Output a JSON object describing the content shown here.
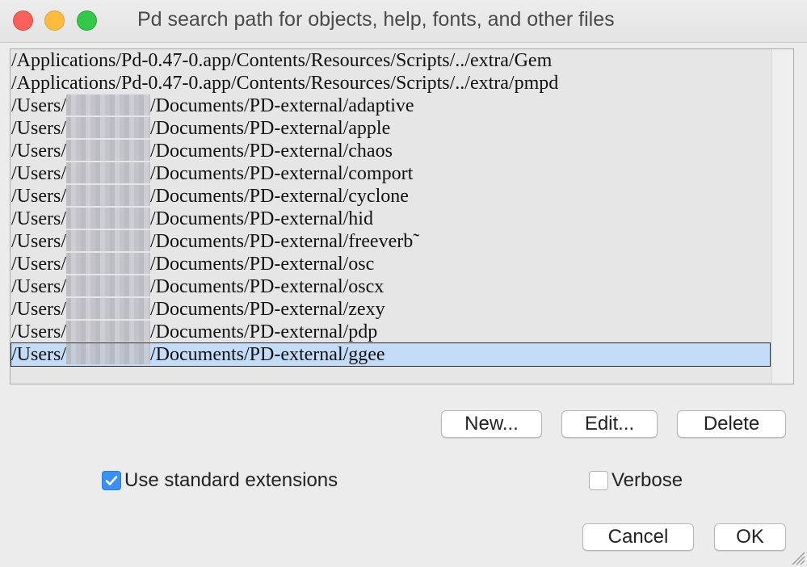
{
  "window": {
    "title": "Pd search path for objects, help, fonts, and other files"
  },
  "path_list": {
    "items": [
      {
        "prefix": "/Applications/Pd-0.47-0.app/Contents/Resources/Scripts/../extra/Gem",
        "redacted": false,
        "suffix": ""
      },
      {
        "prefix": "/Applications/Pd-0.47-0.app/Contents/Resources/Scripts/../extra/pmpd",
        "redacted": false,
        "suffix": ""
      },
      {
        "prefix": "/Users/",
        "redacted": true,
        "suffix": "/Documents/PD-external/adaptive"
      },
      {
        "prefix": "/Users/",
        "redacted": true,
        "suffix": "/Documents/PD-external/apple"
      },
      {
        "prefix": "/Users/",
        "redacted": true,
        "suffix": "/Documents/PD-external/chaos"
      },
      {
        "prefix": "/Users/",
        "redacted": true,
        "suffix": "/Documents/PD-external/comport"
      },
      {
        "prefix": "/Users/",
        "redacted": true,
        "suffix": "/Documents/PD-external/cyclone"
      },
      {
        "prefix": "/Users/",
        "redacted": true,
        "suffix": "/Documents/PD-external/hid"
      },
      {
        "prefix": "/Users/",
        "redacted": true,
        "suffix": "/Documents/PD-external/freeverb˜"
      },
      {
        "prefix": "/Users/",
        "redacted": true,
        "suffix": "/Documents/PD-external/osc"
      },
      {
        "prefix": "/Users/",
        "redacted": true,
        "suffix": "/Documents/PD-external/oscx"
      },
      {
        "prefix": "/Users/",
        "redacted": true,
        "suffix": "/Documents/PD-external/zexy"
      },
      {
        "prefix": "/Users/",
        "redacted": true,
        "suffix": "/Documents/PD-external/pdp"
      },
      {
        "prefix": "/Users/",
        "redacted": true,
        "suffix": "/Documents/PD-external/ggee",
        "selected": true
      }
    ]
  },
  "list_buttons": {
    "new_label": "New...",
    "edit_label": "Edit...",
    "delete_label": "Delete"
  },
  "options": {
    "use_standard_extensions": {
      "label": "Use standard extensions",
      "checked": true
    },
    "verbose": {
      "label": "Verbose",
      "checked": false
    }
  },
  "dialog_buttons": {
    "cancel_label": "Cancel",
    "ok_label": "OK"
  },
  "colors": {
    "selection": "#c4dcf8",
    "checkbox_accent": "#3b8ff5"
  }
}
